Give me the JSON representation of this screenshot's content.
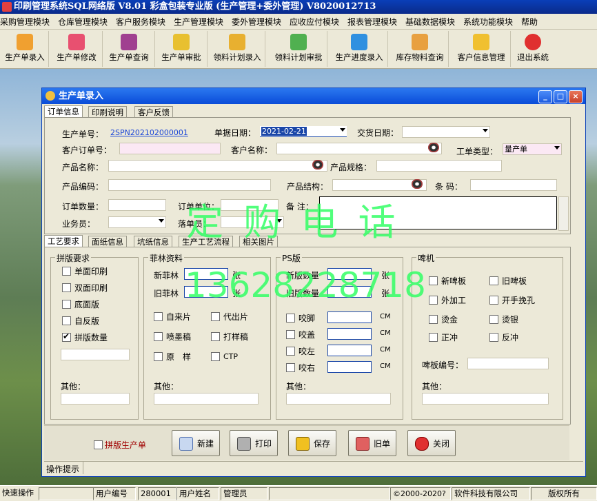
{
  "app_title": "印刷管理系统SQL网络版  V8.01 彩盒包装专业版 (生产管理+委外管理) V8020012713",
  "menu": [
    "采购管理模块",
    "仓库管理模块",
    "客户服务模块",
    "生产管理模块",
    "委外管理模块",
    "应收应付模块",
    "报表管理模块",
    "基础数据模块",
    "系统功能模块",
    "帮助"
  ],
  "toolbar": [
    "生产单录入",
    "生产单修改",
    "生产单查询",
    "生产单审批",
    "领料计划录入",
    "领料计划审批",
    "生产进度录入",
    "库存物料查询",
    "客户信息管理",
    "退出系统"
  ],
  "window": {
    "title": "生产单录入",
    "min": "_",
    "max": "□",
    "close": "×",
    "tabs": [
      "订单信息",
      "印刷说明",
      "客户反馈"
    ],
    "form": {
      "order_no_label": "生产单号：",
      "order_no": "2SPN202102000001",
      "doc_date_label": "单据日期：",
      "doc_date": "2021-02-21",
      "delivery_label": "交货日期：",
      "cust_order_label": "客户订单号：",
      "cust_name_label": "客户名称：",
      "job_type_label": "工单类型：",
      "job_type": "量产单",
      "product_name_label": "产品名称：",
      "product_spec_label": "产品规格：",
      "product_code_label": "产品编码：",
      "product_struct_label": "产品结构：",
      "barcode_label": "条 码：",
      "qty_label": "订单数量：",
      "unit_label": "订单单位：",
      "remark_label": "备 注：",
      "sales_label": "业务员：",
      "cutter_label": "落单员："
    },
    "sub_tabs": [
      "工艺要求",
      "面纸信息",
      "坑纸信息",
      "生产工艺流程",
      "相关图片"
    ],
    "groups": {
      "layout": {
        "title": "拼版要求",
        "items": [
          "单面印刷",
          "双面印刷",
          "底面版",
          "自反版",
          "拼版数量"
        ],
        "checked": [
          false,
          false,
          false,
          false,
          true
        ],
        "other": "其他："
      },
      "film": {
        "title": "菲林资料",
        "new_label": "新菲林",
        "old_label": "旧菲林",
        "unit": "张",
        "items": [
          "自来片",
          "代出片",
          "喷墨稿",
          "打样稿",
          "原　样",
          "CTP"
        ],
        "other": "其他："
      },
      "ps": {
        "title": "PS版",
        "new_label": "新版数量",
        "old_label": "旧版数量",
        "unit": "张",
        "items": [
          "咬脚",
          "咬盖",
          "咬左",
          "咬右"
        ],
        "cm": "CM",
        "other": "其他："
      },
      "die": {
        "title": "啤机",
        "items": [
          "新啤板",
          "旧啤板",
          "外加工",
          "开手挽孔",
          "烫金",
          "烫银",
          "正冲",
          "反冲"
        ],
        "code_label": "啤板编号：",
        "other": "其他："
      }
    },
    "bottom": {
      "checkbox_label": "拼版生产单",
      "buttons": [
        "新建",
        "打印",
        "保存",
        "旧单",
        "关闭"
      ]
    },
    "hint_label": "操作提示"
  },
  "watermark": {
    "line1": "定 购 电 话",
    "line2": "13628228718"
  },
  "status": [
    "快速操作",
    "",
    "用户编号",
    "280001",
    "用户姓名",
    "管理员",
    "",
    "©2000-2020?",
    "软件科技有限公司",
    "版权所有"
  ],
  "colors": {
    "title_blue": "#0a3fb8",
    "window_blue": "#2b78f0",
    "watermark": "#33ff66",
    "link": "#1a46d8",
    "pink": "#fbe8f4"
  }
}
